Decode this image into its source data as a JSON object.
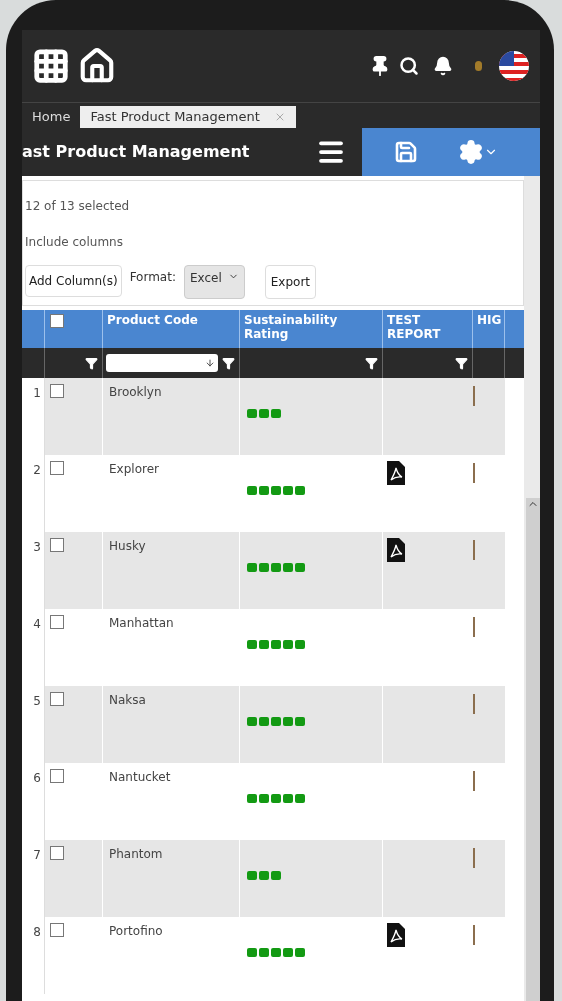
{
  "tabs": [
    {
      "label": "Home",
      "selected": false,
      "closable": false
    },
    {
      "label": "Fast Product Management",
      "selected": true,
      "closable": true
    }
  ],
  "page_title": "ast Product Management",
  "selection_count": "12 of 13 selected",
  "include_columns_label": "Include columns",
  "toolbar": {
    "add_button": "Add Column(s)",
    "format_label": "Format:",
    "format_value": "Excel",
    "export_button": "Export"
  },
  "table": {
    "header_checked": false,
    "columns": [
      "Product Code",
      "Sustainability Rating",
      "TEST REPORT",
      "HIG"
    ],
    "rows": [
      {
        "number": "1",
        "checked": false,
        "product_code": "Brooklyn",
        "stars": 3,
        "test_report": false
      },
      {
        "number": "2",
        "checked": false,
        "product_code": "Explorer",
        "stars": 5,
        "test_report": true
      },
      {
        "number": "3",
        "checked": false,
        "product_code": "Husky",
        "stars": 5,
        "test_report": true
      },
      {
        "number": "4",
        "checked": false,
        "product_code": "Manhattan",
        "stars": 5,
        "test_report": false
      },
      {
        "number": "5",
        "checked": false,
        "product_code": "Naksa",
        "stars": 5,
        "test_report": false
      },
      {
        "number": "6",
        "checked": false,
        "product_code": "Nantucket",
        "stars": 5,
        "test_report": false
      },
      {
        "number": "7",
        "checked": false,
        "product_code": "Phantom",
        "stars": 3,
        "test_report": false
      },
      {
        "number": "8",
        "checked": false,
        "product_code": "Portofino",
        "stars": 5,
        "test_report": true
      }
    ]
  }
}
